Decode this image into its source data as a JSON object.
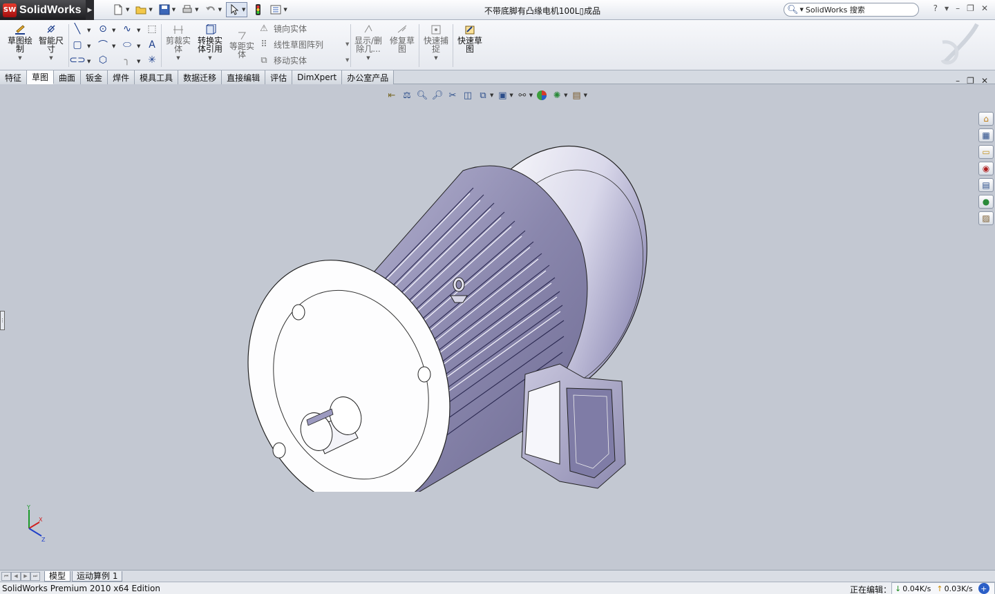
{
  "app": {
    "logo_text": "SolidWorks",
    "doc_title": "不带底脚有凸缘电机100L▯成品",
    "search_placeholder": "SolidWorks 搜索"
  },
  "ribbon": {
    "sketch_draw": "草图绘\n制",
    "smart_dim": "智能尺\n寸",
    "trim": "剪裁实\n体",
    "convert": "转换实\n体引用",
    "offset": "等距实\n体",
    "mirror": "镜向实体",
    "linear_pattern": "线性草图阵列",
    "move": "移动实体",
    "show_delete": "显示/删\n除几...",
    "repair": "修复草\n图",
    "quick_snap": "快速捕\n捉",
    "rapid_sketch": "快速草\n图"
  },
  "tabs": [
    "特征",
    "草图",
    "曲面",
    "钣金",
    "焊件",
    "模具工具",
    "数据迁移",
    "直接编辑",
    "评估",
    "DimXpert",
    "办公室产品"
  ],
  "active_tab": "草图",
  "model_tabs": [
    "模型",
    "运动算例 1"
  ],
  "status": {
    "edition": "SolidWorks Premium 2010 x64 Edition",
    "editing": "正在编辑：",
    "down_speed": "0.04K/s",
    "up_speed": "0.03K/s"
  },
  "triad": {
    "y": "Y",
    "x": "X",
    "z": "Z"
  },
  "colors": {
    "viewport_bg": "#c3c8d2",
    "accent": "#1a3c8a",
    "model_shade": "#9c9ac0"
  },
  "icons": {
    "task_pane": [
      "home-icon",
      "resources-icon",
      "file-explorer-icon",
      "view-palette-icon",
      "design-library-icon",
      "appearances-icon",
      "custom-properties-icon"
    ]
  }
}
